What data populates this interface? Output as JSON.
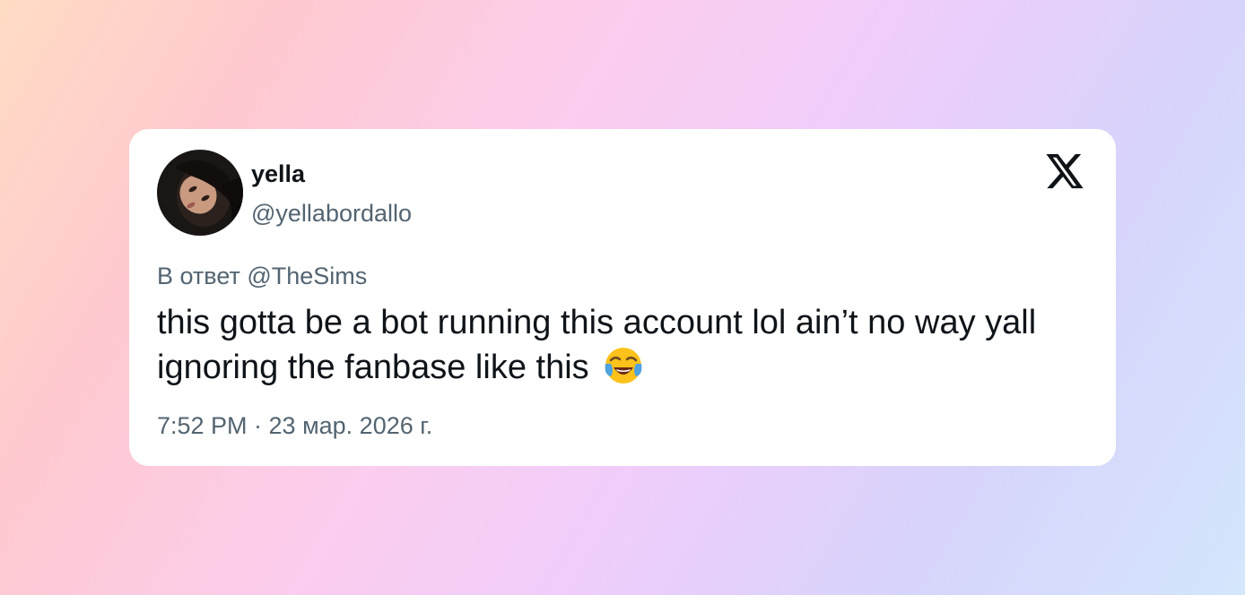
{
  "tweet": {
    "display_name": "yella",
    "handle": "@yellabordallo",
    "reply_to": "В ответ @TheSims",
    "text": "this gotta be a bot running this account lol ain’t no way yall ignoring the fanbase like this",
    "emoji": "face-with-tears-of-joy",
    "timestamp": "7:52 PM · 23 мар. 2026 г.",
    "platform_logo": "x-logo-icon"
  },
  "colors": {
    "primary_text": "#0f1419",
    "secondary_text": "#536471",
    "card_background": "#ffffff"
  }
}
